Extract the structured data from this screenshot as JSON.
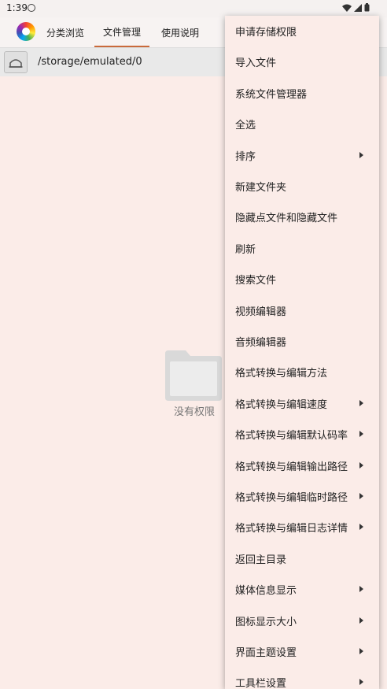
{
  "status_bar": {
    "time": "1:39"
  },
  "tabs": [
    {
      "label": "分类浏览"
    },
    {
      "label": "文件管理"
    },
    {
      "label": "使用说明"
    }
  ],
  "path_bar": {
    "path": "/storage/emulated/0"
  },
  "empty_state": {
    "message": "没有权限"
  },
  "menu": {
    "items": [
      {
        "label": "申请存储权限",
        "has_submenu": false
      },
      {
        "label": "导入文件",
        "has_submenu": false
      },
      {
        "label": "系统文件管理器",
        "has_submenu": false
      },
      {
        "label": "全选",
        "has_submenu": false
      },
      {
        "label": "排序",
        "has_submenu": true
      },
      {
        "label": "新建文件夹",
        "has_submenu": false
      },
      {
        "label": "隐藏点文件和隐藏文件",
        "has_submenu": false
      },
      {
        "label": "刷新",
        "has_submenu": false
      },
      {
        "label": "搜索文件",
        "has_submenu": false
      },
      {
        "label": "视频编辑器",
        "has_submenu": false
      },
      {
        "label": "音频编辑器",
        "has_submenu": false
      },
      {
        "label": "格式转换与编辑方法",
        "has_submenu": false
      },
      {
        "label": "格式转换与编辑速度",
        "has_submenu": true
      },
      {
        "label": "格式转换与编辑默认码率",
        "has_submenu": true
      },
      {
        "label": "格式转换与编辑输出路径",
        "has_submenu": true
      },
      {
        "label": "格式转换与编辑临时路径",
        "has_submenu": true
      },
      {
        "label": "格式转换与编辑日志详情",
        "has_submenu": true
      },
      {
        "label": "返回主目录",
        "has_submenu": false
      },
      {
        "label": "媒体信息显示",
        "has_submenu": true
      },
      {
        "label": "图标显示大小",
        "has_submenu": true
      },
      {
        "label": "界面主题设置",
        "has_submenu": true
      },
      {
        "label": "工具栏设置",
        "has_submenu": true
      }
    ]
  }
}
